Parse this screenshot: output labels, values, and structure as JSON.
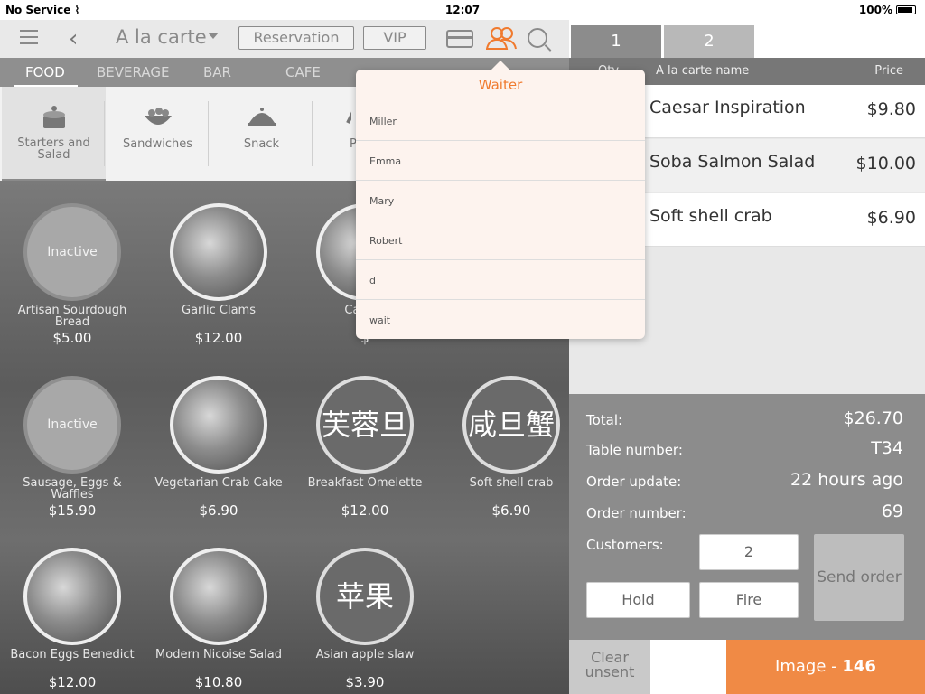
{
  "status_bar": {
    "carrier": "No Service",
    "time": "12:07",
    "battery": "100%"
  },
  "toolbar": {
    "menu_title": "A la carte",
    "reservation_label": "Reservation",
    "vip_label": "VIP"
  },
  "categories": [
    "FOOD",
    "BEVERAGE",
    "BAR",
    "CAFE"
  ],
  "sub_categories": [
    {
      "label": "Starters and Salad",
      "icon": "cake-icon"
    },
    {
      "label": "Sandwiches",
      "icon": "salad-bowl-icon"
    },
    {
      "label": "Snack",
      "icon": "cloche-icon"
    },
    {
      "label": "P",
      "icon": "dish-icon"
    }
  ],
  "menu_items": [
    {
      "name": "Artisan Sourdough Bread",
      "price": "$5.00",
      "state": "Inactive"
    },
    {
      "name": "Garlic Clams",
      "price": "$12.00"
    },
    {
      "name": "Caesar",
      "price": "$"
    },
    {
      "name": "Sausage, Eggs & Waffles",
      "price": "$15.90",
      "state": "Inactive"
    },
    {
      "name": "Vegetarian Crab Cake",
      "price": "$6.90"
    },
    {
      "name": "Breakfast Omelette",
      "price": "$12.00",
      "chinese": "芙蓉旦"
    },
    {
      "name": "Soft shell crab",
      "price": "$6.90",
      "chinese": "咸旦蟹"
    },
    {
      "name": "Bacon Eggs Benedict",
      "price": "$12.00"
    },
    {
      "name": "Modern Nicoise Salad",
      "price": "$10.80"
    },
    {
      "name": "Asian apple slaw",
      "price": "$3.90",
      "chinese": "苹果"
    }
  ],
  "order": {
    "tabs": [
      "1",
      "2"
    ],
    "headers": {
      "qty": "Qty",
      "name": "A la carte name",
      "price": "Price"
    },
    "rows": [
      {
        "name": "Caesar Inspiration",
        "price": "$9.80"
      },
      {
        "name": "Soba Salmon Salad",
        "price": "$10.00"
      },
      {
        "name": "Soft shell crab",
        "price": "$6.90"
      }
    ]
  },
  "summary": {
    "total_label": "Total:",
    "total_value": "$26.70",
    "table_label": "Table number:",
    "table_value": "T34",
    "update_label": "Order update:",
    "update_value": "22 hours ago",
    "order_num_label": "Order number:",
    "order_num_value": "69",
    "customers_label": "Customers:",
    "customers_value": "2",
    "hold_label": "Hold",
    "fire_label": "Fire",
    "send_label": "Send order"
  },
  "bottom": {
    "clear_label": "Clear unsent",
    "image_label": "Image - ",
    "image_count": "146"
  },
  "waiter_popover": {
    "title": "Waiter",
    "items": [
      "Miller",
      "Emma",
      "Mary",
      "Robert",
      "d",
      "wait"
    ]
  },
  "colors": {
    "accent": "#f07a2e",
    "panel_gray": "#8c8c8c",
    "image_button": "#f08a45"
  }
}
